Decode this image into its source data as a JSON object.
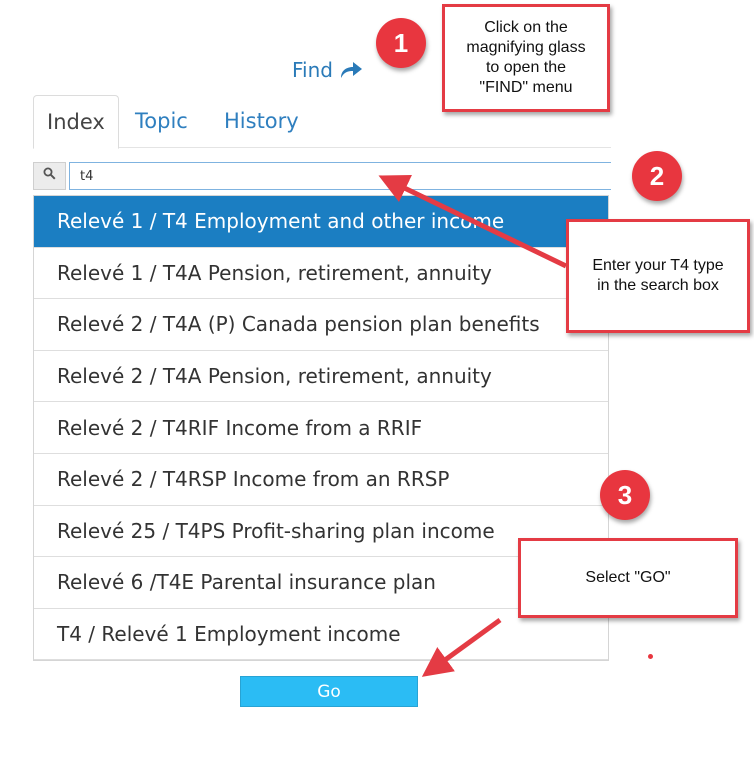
{
  "find": {
    "label": "Find"
  },
  "tabs": [
    {
      "label": "Index",
      "active": true
    },
    {
      "label": "Topic",
      "active": false
    },
    {
      "label": "History",
      "active": false
    }
  ],
  "search": {
    "value": "t4"
  },
  "results": [
    {
      "label": "Relevé 1 / T4 Employment and other income",
      "selected": true
    },
    {
      "label": "Relevé 1 / T4A Pension, retirement, annuity"
    },
    {
      "label": "Relevé 2 / T4A (P) Canada pension plan benefits"
    },
    {
      "label": "Relevé 2 / T4A Pension, retirement, annuity"
    },
    {
      "label": "Relevé 2 / T4RIF Income from a RRIF"
    },
    {
      "label": "Relevé 2 / T4RSP Income from an RRSP"
    },
    {
      "label": "Relevé 25 / T4PS Profit-sharing plan income"
    },
    {
      "label": "Relevé 6 /T4E Parental insurance plan"
    },
    {
      "label": "T4 / Relevé 1 Employment income"
    }
  ],
  "go_button": {
    "label": "Go"
  },
  "annotations": {
    "step1": {
      "number": "1",
      "text": "Click on the\nmagnifying glass\nto open the\n\"FIND\" menu"
    },
    "step2": {
      "number": "2",
      "text": "Enter your T4 type\nin the search box"
    },
    "step3": {
      "number": "3",
      "text": "Select \"GO\""
    }
  },
  "colors": {
    "accent": "#1b7ec2",
    "go": "#2bbcf4",
    "callout_red": "#e43b44",
    "link": "#2a7ab8"
  },
  "icons": {
    "find": "share-arrow-icon",
    "search": "magnifier-icon"
  }
}
